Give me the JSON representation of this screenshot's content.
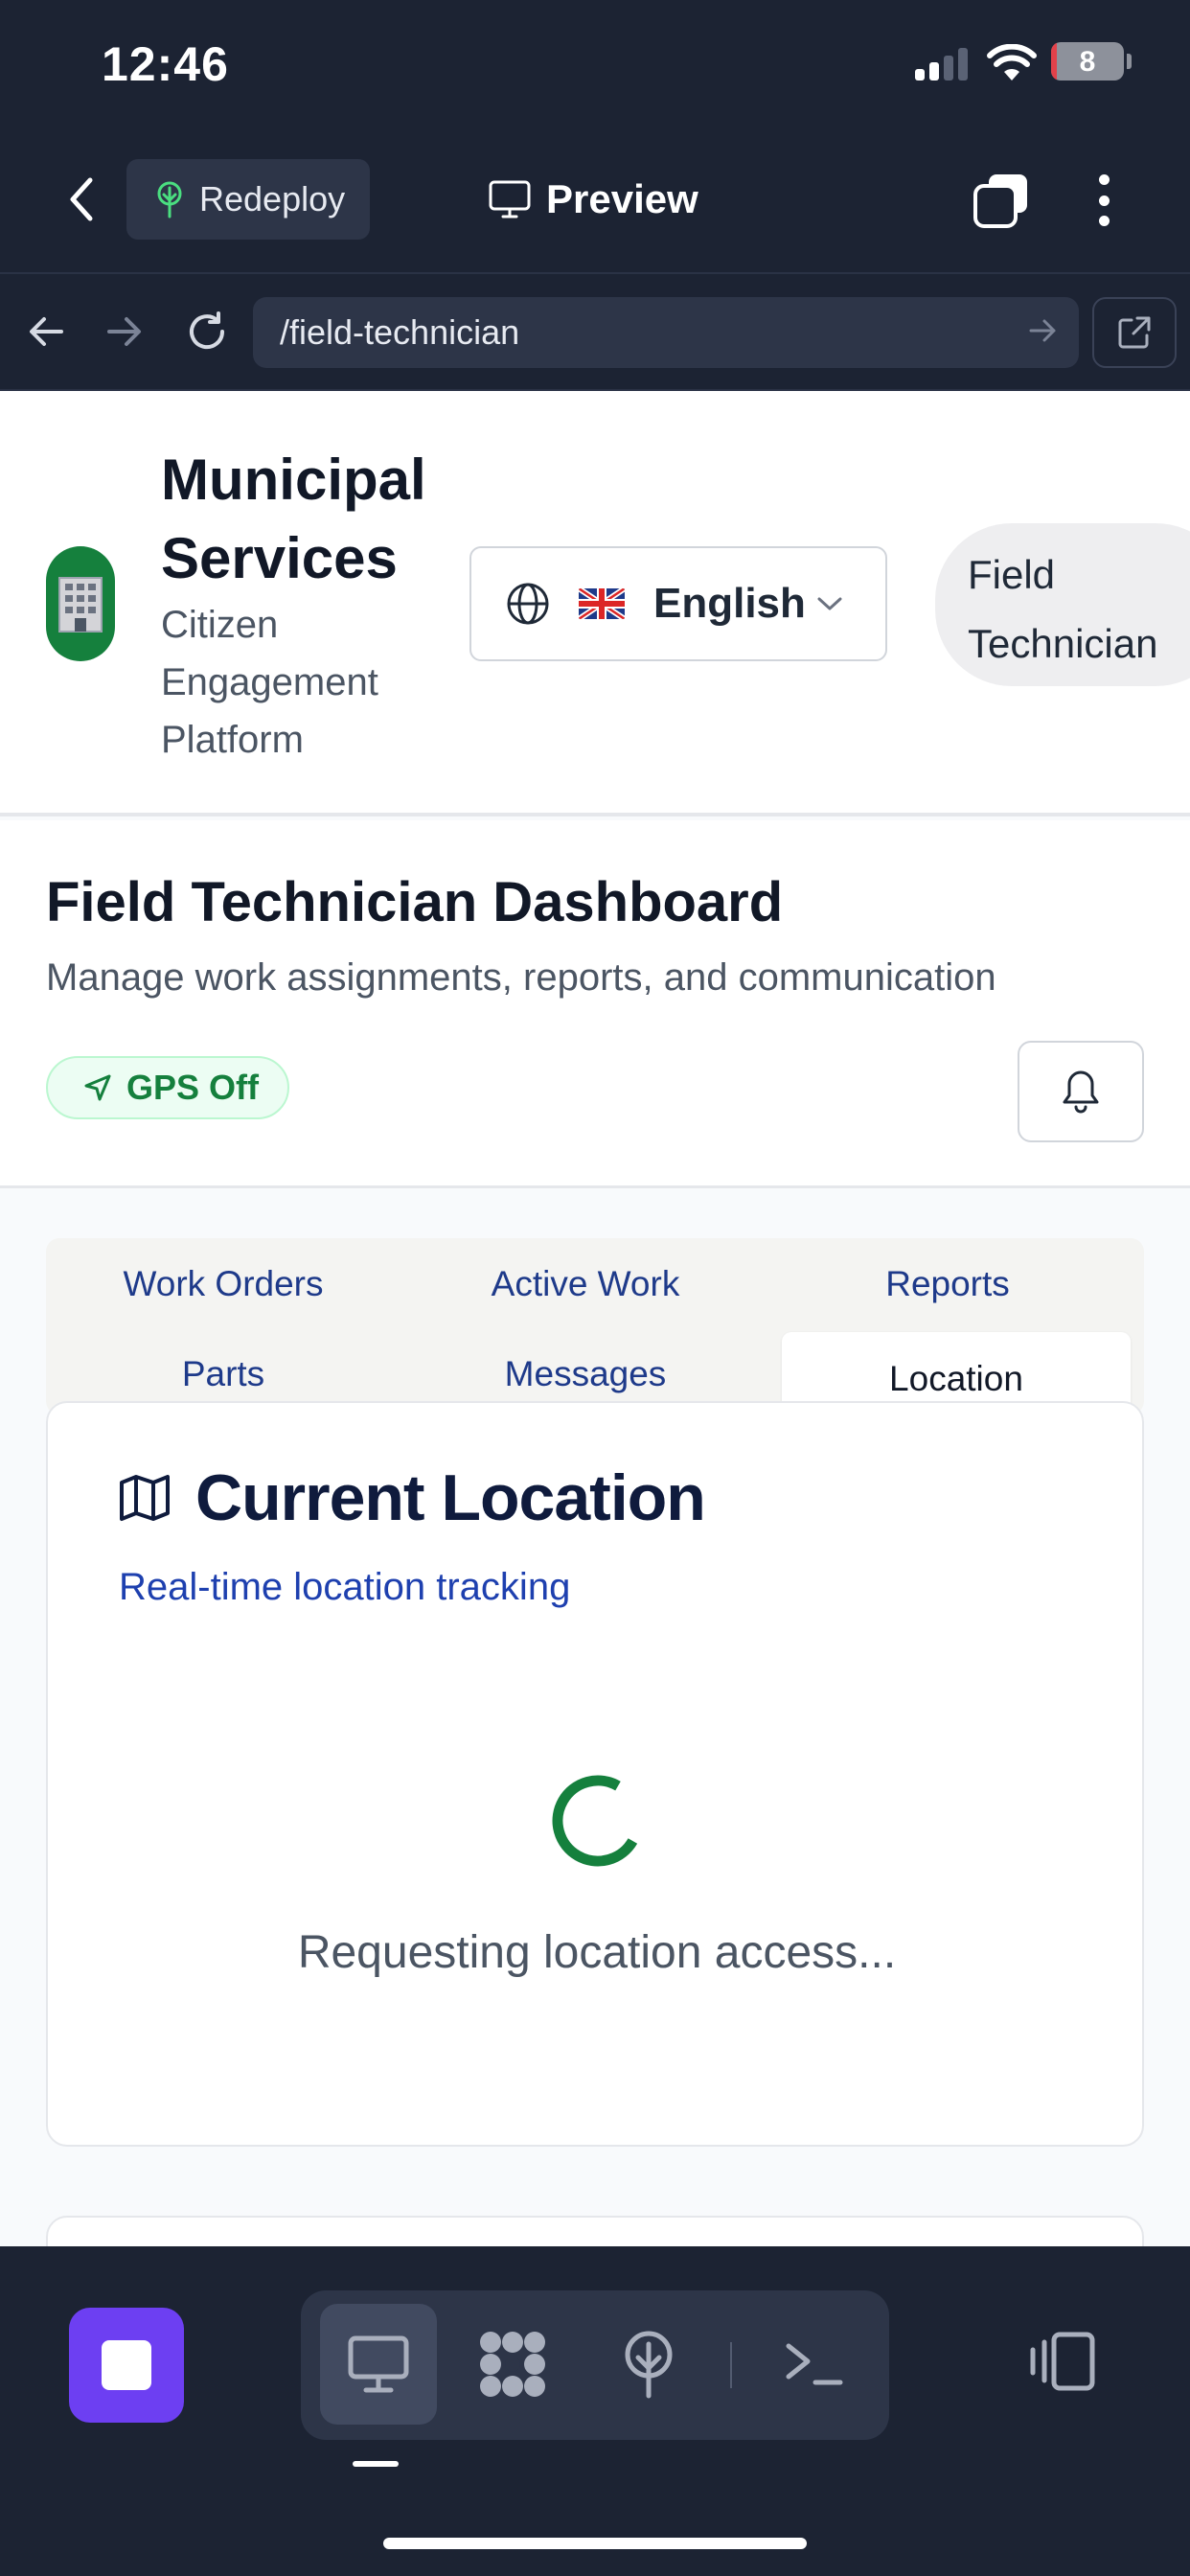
{
  "status_bar": {
    "time": "12:46",
    "battery_level": "8",
    "battery_fraction": 0.08
  },
  "app_bar": {
    "redeploy_label": "Redeploy",
    "preview_label": "Preview"
  },
  "browser": {
    "url": "/field-technician"
  },
  "site_header": {
    "title": "Municipal Services",
    "subtitle": "Citizen Engagement Platform",
    "language": "English",
    "role": "Field Technician"
  },
  "dashboard": {
    "title": "Field Technician Dashboard",
    "subtitle": "Manage work assignments, reports, and communication",
    "gps_status": "GPS Off"
  },
  "tabs": [
    {
      "label": "Work Orders"
    },
    {
      "label": "Active Work"
    },
    {
      "label": "Reports"
    },
    {
      "label": "Parts"
    },
    {
      "label": "Messages"
    },
    {
      "label": "Location"
    }
  ],
  "active_tab": "Location",
  "location_card": {
    "title": "Current Location",
    "subtitle": "Real-time location tracking",
    "loading_text": "Requesting location access..."
  },
  "icons": {
    "back": "chevron-left-icon",
    "redeploy": "tree-icon",
    "preview": "monitor-icon",
    "tabs": "tabs-icon",
    "more": "more-vertical-icon",
    "language": "globe-icon",
    "flag": "uk-flag-icon",
    "gps": "navigation-icon",
    "notifications": "bell-icon",
    "map": "map-icon",
    "stop": "stop-icon",
    "terminal": "terminal-icon"
  },
  "colors": {
    "chrome_bg": "#1c2333",
    "accent_green": "#15803d",
    "stop_purple": "#6d3ff2",
    "tab_text": "#1e3a8a"
  }
}
